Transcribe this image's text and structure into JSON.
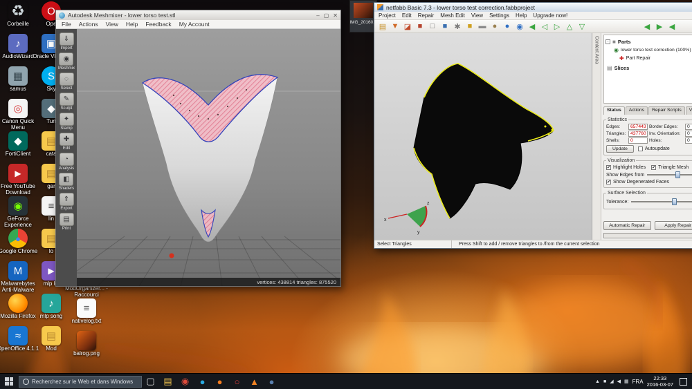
{
  "desktop": {
    "col1": [
      {
        "name": "shortcut-corbeille",
        "icon": "recycle-bin-icon",
        "label": "Corbeille",
        "glyph": "♻",
        "bg": "transparent",
        "fg": "#cfd8dc",
        "fs": "22px"
      },
      {
        "name": "shortcut-audiowizard",
        "icon": "audiowizard-icon",
        "label": "AudioWizard",
        "glyph": "♪",
        "bg": "#5c6bc0",
        "fg": "#ffffff"
      },
      {
        "name": "shortcut-samus",
        "icon": "image-file-icon",
        "label": "samus",
        "glyph": "▦",
        "bg": "#90a4ae",
        "fg": "#37474f"
      },
      {
        "name": "shortcut-canon-quick-menu",
        "icon": "canon-quick-menu-icon",
        "label": "Canon Quick Menu",
        "glyph": "◎",
        "bg": "#f5f5f5",
        "fg": "#d32f2f"
      },
      {
        "name": "shortcut-forticlient",
        "icon": "forticlient-icon",
        "label": "FortiClient",
        "glyph": "◆",
        "bg": "#00695c",
        "fg": "#ffffff"
      },
      {
        "name": "shortcut-free-youtube-download",
        "icon": "free-youtube-download-icon",
        "label": "Free YouTube Download",
        "glyph": "▶",
        "bg": "#c62828",
        "fg": "#ffffff",
        "fs": "12px"
      },
      {
        "name": "shortcut-geforce-experience",
        "icon": "geforce-experience-icon",
        "label": "GeForce Experience",
        "glyph": "◉",
        "bg": "#263238",
        "fg": "#76ff03"
      },
      {
        "name": "shortcut-google-chrome",
        "icon": "google-chrome-icon",
        "label": "Google Chrome",
        "glyph": "●",
        "bg": "conic-gradient(from 0deg, #ea4335 0deg 120deg, #fbbc05 120deg 240deg, #34a853 240deg 360deg)",
        "fg": "#4285f4",
        "radius": "50%",
        "fs": "13px"
      },
      {
        "name": "shortcut-malwarebytes",
        "icon": "malwarebytes-icon",
        "label": "Malwarebytes Anti-Malware",
        "glyph": "M",
        "bg": "#1565c0",
        "fg": "#ffffff"
      },
      {
        "name": "shortcut-mozilla-firefox",
        "icon": "mozilla-firefox-icon",
        "label": "Mozilla Firefox",
        "glyph": "",
        "bg": "radial-gradient(circle at 35% 35%, #ffd54f, #ff8f00 60%, #e65100)",
        "fg": "#ffffff",
        "radius": "50%"
      },
      {
        "name": "shortcut-openoffice",
        "icon": "openoffice-icon",
        "label": "OpenOffice 4.1.1",
        "glyph": "≈",
        "bg": "#1976d2",
        "fg": "#ffffff"
      }
    ],
    "col2": [
      {
        "name": "shortcut-ope",
        "icon": "opera-icon",
        "label": "Ope",
        "glyph": "O",
        "bg": "#cc0f16",
        "fg": "#ffffff",
        "radius": "50%"
      },
      {
        "name": "shortcut-oracle-virtualbox",
        "icon": "virtualbox-icon",
        "label": "Oracle Virtua...",
        "glyph": "▣",
        "bg": "#2e6fc2",
        "fg": "#ffffff"
      },
      {
        "name": "shortcut-sky",
        "icon": "skype-icon",
        "label": "Sky",
        "glyph": "S",
        "bg": "#00aff0",
        "fg": "#ffffff",
        "radius": "50%"
      },
      {
        "name": "shortcut-tun",
        "icon": "app-icon",
        "label": "Tun",
        "glyph": "◆",
        "bg": "#546e7a",
        "fg": "#ffffff"
      },
      {
        "name": "shortcut-cata",
        "icon": "folder-icon",
        "label": "cata",
        "glyph": "▤",
        "bg": "#f7c94c",
        "fg": "#b98a2f"
      },
      {
        "name": "shortcut-gar",
        "icon": "folder-icon",
        "label": "gar",
        "glyph": "▤",
        "bg": "#f7c94c",
        "fg": "#b98a2f"
      },
      {
        "name": "shortcut-lin",
        "icon": "text-file-icon",
        "label": "lin",
        "glyph": "≡",
        "bg": "#f5f5f5",
        "fg": "#555555"
      },
      {
        "name": "shortcut-lo",
        "icon": "folder-icon",
        "label": "lo",
        "glyph": "▤",
        "bg": "#f7c94c",
        "fg": "#b98a2f"
      },
      {
        "name": "shortcut-mlp-lol",
        "icon": "media-file-icon",
        "label": "mlp lol",
        "glyph": "▶",
        "bg": "#7e57c2",
        "fg": "#ffffff",
        "fs": "12px"
      },
      {
        "name": "shortcut-mlp-song",
        "icon": "audio-file-icon",
        "label": "mlp song",
        "glyph": "♪",
        "bg": "#26a69a",
        "fg": "#ffffff"
      },
      {
        "name": "shortcut-mod",
        "icon": "folder-icon",
        "label": "Mod",
        "glyph": "▤",
        "bg": "#f7c94c",
        "fg": "#b98a2f"
      }
    ],
    "col3": [
      {
        "name": "shortcut-modorganizer",
        "icon": "modorganizer-icon",
        "label": "ModOrganizer... - Raccourci",
        "glyph": "◙",
        "bg": "#37474f",
        "fg": "#90caf9"
      },
      {
        "name": "shortcut-nativelog",
        "icon": "text-file-icon",
        "label": "nativelog.txt",
        "glyph": "≡",
        "bg": "#fafafa",
        "fg": "#666666"
      },
      {
        "name": "shortcut-balrog",
        "icon": "image-file-icon",
        "label": "balrog.png",
        "glyph": "",
        "bg": "linear-gradient(135deg,#e06414,#7a2e0e 65%,#2a1208)",
        "fg": "#ffffff"
      }
    ]
  },
  "img_window": {
    "label": "IMG_20160..."
  },
  "meshmixer": {
    "title": "Autodesk Meshmixer - lower torso test.stl",
    "controls": {
      "minimize": "–",
      "maximize": "▢",
      "close": "✕"
    },
    "menu": [
      "File",
      "Actions",
      "View",
      "Help",
      "Feedback",
      "My Account"
    ],
    "tools": [
      {
        "name": "tool-import",
        "label": "Import",
        "glyph": "⇓"
      },
      {
        "name": "tool-meshmix",
        "label": "Meshmix",
        "glyph": "◉"
      },
      {
        "name": "tool-select",
        "label": "Select",
        "glyph": "◌"
      },
      {
        "name": "tool-sculpt",
        "label": "Sculpt",
        "glyph": "✎"
      },
      {
        "name": "tool-stamp",
        "label": "Stamp",
        "glyph": "✦"
      },
      {
        "name": "tool-edit",
        "label": "Edit",
        "glyph": "✚"
      },
      {
        "name": "tool-analysis",
        "label": "Analysis",
        "glyph": "◔"
      },
      {
        "name": "tool-shaders",
        "label": "Shaders",
        "glyph": "◧"
      },
      {
        "name": "tool-export",
        "label": "Export",
        "glyph": "⇑"
      },
      {
        "name": "tool-print",
        "label": "Print",
        "glyph": "▤"
      }
    ],
    "status": "vertices: 438814   triangles: 875520"
  },
  "netfabb": {
    "title": "netfabb Basic 7.3 - lower torso test correction.fabbproject",
    "menu": [
      "Project",
      "Edit",
      "Repair",
      "Mesh Edit",
      "View",
      "Settings",
      "Help",
      "Upgrade now!"
    ],
    "toolbar": [
      {
        "name": "open-project-icon",
        "glyph": "▤",
        "color": "#c9942f"
      },
      {
        "name": "save-project-icon",
        "glyph": "▼",
        "color": "#d06a28"
      },
      {
        "name": "add-part-icon",
        "glyph": "◪",
        "color": "#c14a2a"
      },
      {
        "name": "cube-red-icon",
        "glyph": "■",
        "color": "#b5432e"
      },
      {
        "name": "cube-outline-icon",
        "glyph": "□",
        "color": "#6a6a6a"
      },
      {
        "name": "cube-blue-icon",
        "glyph": "■",
        "color": "#3a6fb0"
      },
      {
        "name": "settings-icon",
        "glyph": "✱",
        "color": "#7a7a7a"
      },
      {
        "name": "cube-yellow-icon",
        "glyph": "■",
        "color": "#cfa01f"
      },
      {
        "name": "platform-icon",
        "glyph": "▬",
        "color": "#8a8a8a"
      },
      {
        "name": "sphere-icon",
        "glyph": "●",
        "color": "#9a8050"
      },
      {
        "name": "zoom-icon",
        "glyph": "●",
        "color": "#2f6fc4"
      },
      {
        "name": "zoom-window-icon",
        "glyph": "◉",
        "color": "#2f6fc4"
      },
      {
        "name": "select-triangles-icon",
        "glyph": "◀",
        "color": "#3aa53f"
      },
      {
        "name": "view-left-icon",
        "glyph": "◁",
        "color": "#3aa53f"
      },
      {
        "name": "view-right-icon",
        "glyph": "▷",
        "color": "#3aa53f"
      },
      {
        "name": "view-top-icon",
        "glyph": "△",
        "color": "#3aa53f"
      },
      {
        "name": "view-bottom-icon",
        "glyph": "▽",
        "color": "#3aa53f"
      }
    ],
    "toolbar_right": [
      {
        "name": "rotate-left-icon",
        "glyph": "◀",
        "color": "#3aa53f"
      },
      {
        "name": "rotate-right-icon",
        "glyph": "▶",
        "color": "#3aa53f"
      },
      {
        "name": "fit-view-icon",
        "glyph": "◀",
        "color": "#3aa53f"
      }
    ],
    "context_area": "Context Area",
    "check": "✔",
    "tree": {
      "expander": "-",
      "parts_glyph": "■",
      "parts": "Parts",
      "part_glyph": "◉",
      "part": "lower torso test correction (100%)",
      "repair_glyph": "✚",
      "repair": "Part Repair",
      "slices_glyph": "▤",
      "slices": "Slices"
    },
    "tabs": [
      "Status",
      "Actions",
      "Repair Scripts",
      "View"
    ],
    "stats": {
      "legend": "Statistics",
      "rows": [
        {
          "l1": "Edges:",
          "v1": "657443",
          "c1": "#cc0000",
          "l2": "Border Edges:",
          "v2": "0",
          "c2": "#222222"
        },
        {
          "l1": "Triangles:",
          "v1": "437760",
          "c1": "#cc0000",
          "l2": "Inv. Orientation:",
          "v2": "0",
          "c2": "#222222"
        },
        {
          "l1": "Shells:",
          "v1": "0",
          "c1": "#cc0000",
          "l2": "Holes:",
          "v2": "0",
          "c2": "#222222"
        }
      ],
      "update": "Update",
      "autoupdate": "Autoupdate"
    },
    "visualization": {
      "legend": "Visualization",
      "cb1": "Highlight Holes",
      "cb2": "Triangle Mesh",
      "edges_label": "Show Edges from",
      "cb3": "Show Degenerated Faces"
    },
    "surface": {
      "legend": "Surface Selection",
      "tolerance": "Tolerance:"
    },
    "buttons": {
      "auto": "Automatic Repair",
      "apply": "Apply Repair"
    },
    "statusbar": {
      "left": "Select Triangles",
      "hint": "Press Shift to add / remove triangles to /from the current selection"
    }
  },
  "taskbar": {
    "search_placeholder": "Recherchez sur le Web et dans Windows",
    "apps": [
      {
        "name": "task-view-icon",
        "glyph": "▢",
        "color": "#e0e0e0"
      },
      {
        "name": "file-explorer-icon",
        "glyph": "▤",
        "color": "#eec04e"
      },
      {
        "name": "chrome-icon",
        "glyph": "◉",
        "color": "#de4b3b"
      },
      {
        "name": "skype-icon",
        "glyph": "●",
        "color": "#29a9e0"
      },
      {
        "name": "firefox-icon",
        "glyph": "●",
        "color": "#f57c1f"
      },
      {
        "name": "opera-icon",
        "glyph": "○",
        "color": "#e43e3e"
      },
      {
        "name": "vlc-icon",
        "glyph": "▲",
        "color": "#f28322"
      },
      {
        "name": "steam-icon",
        "glyph": "●",
        "color": "#5a7fae"
      }
    ],
    "tray_icons": [
      {
        "name": "hidden-icons-chevron",
        "glyph": "▲"
      },
      {
        "name": "system-icon",
        "glyph": "■"
      },
      {
        "name": "network-icon",
        "glyph": "◢"
      },
      {
        "name": "volume-icon",
        "glyph": "◀"
      },
      {
        "name": "touch-icon",
        "glyph": "▦"
      }
    ],
    "lang": "FRA",
    "time": "22:33",
    "date": "2016-03-07"
  }
}
